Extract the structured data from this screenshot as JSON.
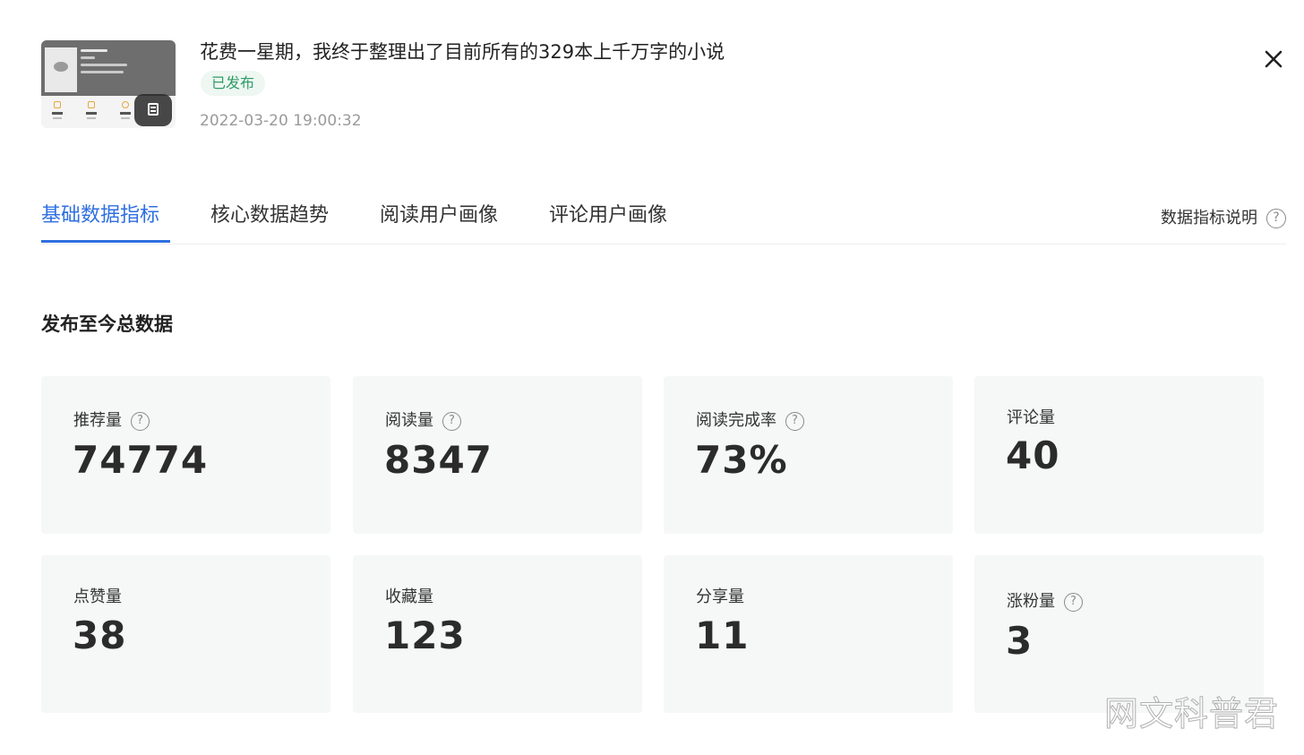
{
  "article": {
    "title": "花费一星期，我终于整理出了目前所有的329本上千万字的小说",
    "status": "已发布",
    "publish_time": "2022-03-20 19:00:32",
    "thumbnail_icon": "article-preview-thumbnail",
    "doc_icon": "document-icon"
  },
  "header": {
    "close_icon": "close-icon"
  },
  "tabs": [
    {
      "label": "基础数据指标",
      "active": true
    },
    {
      "label": "核心数据趋势",
      "active": false
    },
    {
      "label": "阅读用户画像",
      "active": false
    },
    {
      "label": "评论用户画像",
      "active": false
    }
  ],
  "metric_help": {
    "label": "数据指标说明",
    "icon": "question-icon"
  },
  "section": {
    "title": "发布至今总数据"
  },
  "metrics": [
    {
      "label": "推荐量",
      "value": "74774",
      "has_help": true
    },
    {
      "label": "阅读量",
      "value": "8347",
      "has_help": true
    },
    {
      "label": "阅读完成率",
      "value": "73%",
      "has_help": true
    },
    {
      "label": "评论量",
      "value": "40",
      "has_help": false
    },
    {
      "label": "点赞量",
      "value": "38",
      "has_help": false
    },
    {
      "label": "收藏量",
      "value": "123",
      "has_help": false
    },
    {
      "label": "分享量",
      "value": "11",
      "has_help": false
    },
    {
      "label": "涨粉量",
      "value": "3",
      "has_help": true
    }
  ],
  "watermark": "网文科普君",
  "colors": {
    "accent": "#2f6fe0",
    "status_green": "#2e9c66",
    "card_bg": "#f6f7f7"
  }
}
